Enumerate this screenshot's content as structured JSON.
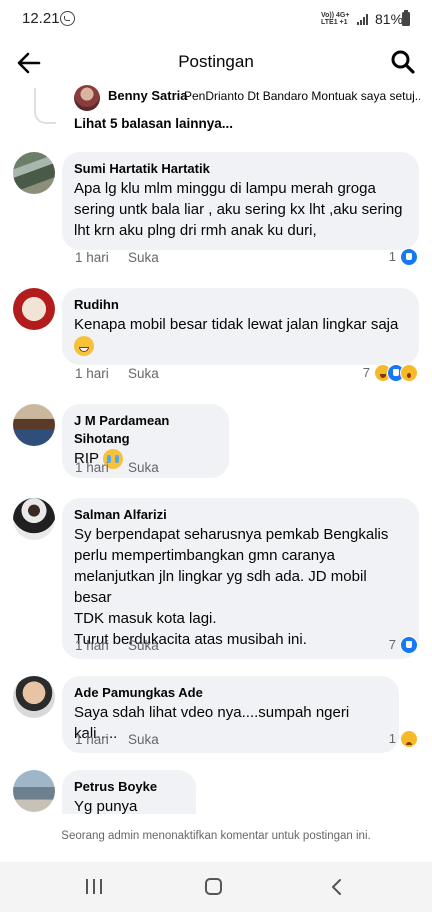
{
  "status": {
    "time": "12.21",
    "net_top": "Vo)) 4G+",
    "net_bottom": "LTE1 +1",
    "battery": "81%"
  },
  "header": {
    "title": "Postingan"
  },
  "reply_preview": {
    "name": "Benny Satria",
    "text": "PenDrianto Dt Bandaro Montuak saya setuj...",
    "more": "Lihat 5 balasan lainnya..."
  },
  "comments": [
    {
      "name": "Sumi Hartatik Hartatik",
      "lines": [
        "Apa lg klu mlm minggu di lampu merah groga",
        "sering untk bala liar , aku sering kx lht ,aku sering",
        "lht krn aku plng dri rmh anak ku duri,"
      ],
      "time": "1 hari",
      "like": "Suka",
      "reaction_count": "1",
      "reactions": [
        "like"
      ]
    },
    {
      "name": "Rudihn",
      "lines": [
        "Kenapa mobil besar tidak lewat jalan lingkar saja"
      ],
      "emoji": "grin",
      "time": "1 hari",
      "like": "Suka",
      "reaction_count": "7",
      "reactions": [
        "haha",
        "like",
        "wow"
      ]
    },
    {
      "name": "J M Pardamean Sihotang",
      "lines": [
        "RIP"
      ],
      "emoji": "cry",
      "time": "1 hari",
      "like": "Suka",
      "reaction_count": "",
      "reactions": []
    },
    {
      "name": "Salman Alfarizi",
      "lines": [
        "Sy berpendapat seharusnya pemkab Bengkalis",
        "perlu mempertimbangkan gmn caranya",
        "melanjutkan jln lingkar yg sdh ada. JD mobil besar",
        "TDK masuk kota lagi.",
        "Turut berdukacita atas musibah ini."
      ],
      "time": "1 hari",
      "like": "Suka",
      "reaction_count": "7",
      "reactions": [
        "like"
      ]
    },
    {
      "name": "Ade Pamungkas Ade",
      "lines": [
        "Saya sdah lihat vdeo nya....sumpah ngeri kali....."
      ],
      "time": "1 hari",
      "like": "Suka",
      "reaction_count": "1",
      "reactions": [
        "sad"
      ]
    },
    {
      "name": "Petrus Boyke",
      "lines": [
        "Yg punya stavan"
      ]
    }
  ],
  "footer_note": "Seorang admin menonaktifkan komentar untuk postingan ini.",
  "colors": {
    "bubble": "#f0f2f5",
    "meta": "#65676b",
    "like_blue": "#1877f2"
  },
  "icons": {
    "back": "arrow-left-icon",
    "search": "search-icon"
  }
}
